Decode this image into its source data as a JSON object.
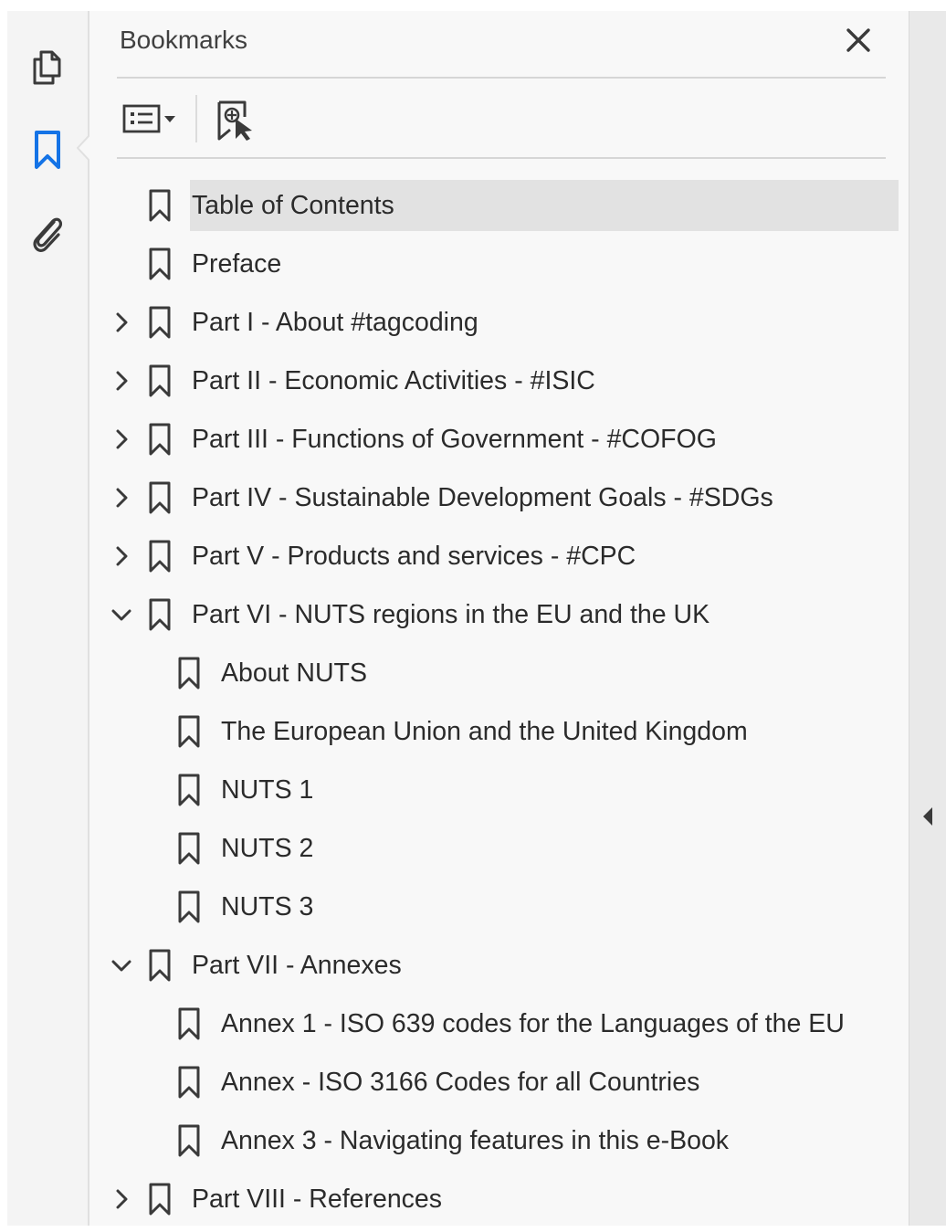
{
  "rail": {
    "items": [
      {
        "name": "page-thumbnails",
        "icon": "copy-pages-icon"
      },
      {
        "name": "bookmarks",
        "icon": "bookmark-icon",
        "active": true
      },
      {
        "name": "attachments",
        "icon": "paperclip-icon"
      }
    ],
    "active_color": "#1473e6"
  },
  "panel": {
    "title": "Bookmarks",
    "close_icon": "close-icon",
    "toolbar": {
      "options_icon": "list-options-icon",
      "options_caret": "chevron-down-icon",
      "new_bookmark_icon": "new-bookmark-icon"
    }
  },
  "bookmarks": [
    {
      "label": "Table of Contents",
      "level": 0,
      "expandable": false,
      "selected": true
    },
    {
      "label": "Preface",
      "level": 0,
      "expandable": false
    },
    {
      "label": "Part I - About #tagcoding",
      "level": 0,
      "expandable": true,
      "expanded": false
    },
    {
      "label": "Part II - Economic Activities - #ISIC",
      "level": 0,
      "expandable": true,
      "expanded": false
    },
    {
      "label": "Part III - Functions of Government - #COFOG",
      "level": 0,
      "expandable": true,
      "expanded": false
    },
    {
      "label": "Part IV - Sustainable Development Goals - #SDGs",
      "level": 0,
      "expandable": true,
      "expanded": false
    },
    {
      "label": "Part V - Products and services - #CPC",
      "level": 0,
      "expandable": true,
      "expanded": false
    },
    {
      "label": "Part VI - NUTS regions in the EU and the UK",
      "level": 0,
      "expandable": true,
      "expanded": true
    },
    {
      "label": "About NUTS",
      "level": 1,
      "expandable": false
    },
    {
      "label": "The European Union and the United Kingdom",
      "level": 1,
      "expandable": false
    },
    {
      "label": "NUTS 1",
      "level": 1,
      "expandable": false
    },
    {
      "label": "NUTS 2",
      "level": 1,
      "expandable": false
    },
    {
      "label": "NUTS 3",
      "level": 1,
      "expandable": false
    },
    {
      "label": "Part VII - Annexes",
      "level": 0,
      "expandable": true,
      "expanded": true
    },
    {
      "label": "Annex 1 - ISO 639 codes for the Languages of the EU",
      "level": 1,
      "expandable": false
    },
    {
      "label": "Annex - ISO 3166 Codes for all Countries",
      "level": 1,
      "expandable": false
    },
    {
      "label": "Annex 3 - Navigating features in this e-Book",
      "level": 1,
      "expandable": false
    },
    {
      "label": "Part VIII - References",
      "level": 0,
      "expandable": true,
      "expanded": false
    }
  ],
  "right_strip": {
    "collapse_icon": "collapse-left-icon"
  }
}
